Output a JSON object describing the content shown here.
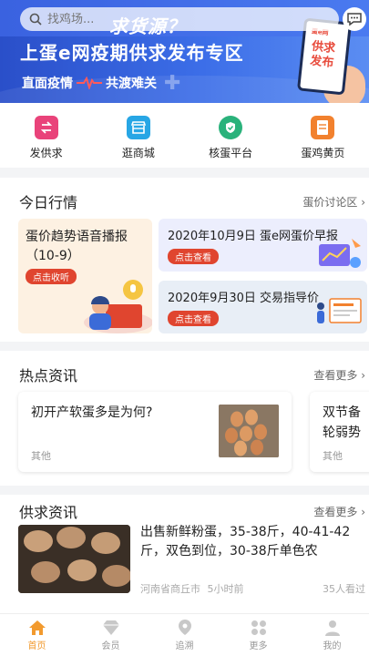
{
  "search": {
    "placeholder": "找鸡场..."
  },
  "banner": {
    "tagline": "求货源？",
    "headline": "上蛋e网疫期供求发布专区",
    "sub_left": "直面疫情",
    "sub_right": "共渡难关",
    "phone_logo": "蛋e网",
    "phone_text": "供求发布"
  },
  "quicknav": [
    {
      "label": "发供求",
      "icon": "exchange-icon",
      "color": "#e9437a"
    },
    {
      "label": "逛商城",
      "icon": "store-icon",
      "color": "#27a6e5"
    },
    {
      "label": "核蛋平台",
      "icon": "shield-check-icon",
      "color": "#2ab27b"
    },
    {
      "label": "蛋鸡黄页",
      "icon": "book-icon",
      "color": "#f2812e"
    }
  ],
  "market": {
    "title": "今日行情",
    "more": "蛋价讨论区 ›",
    "card_left": {
      "title": "蛋价趋势语音播报（10-9）",
      "button": "点击收听"
    },
    "card_right_top": {
      "title": "2020年10月9日 蛋e网蛋价早报",
      "button": "点击查看"
    },
    "card_right_bottom": {
      "title": "2020年9月30日 交易指导价",
      "button": "点击查看"
    }
  },
  "hot": {
    "title": "热点资讯",
    "more": "查看更多 ›",
    "items": [
      {
        "title": "初开产软蛋多是为何?",
        "category": "其他"
      },
      {
        "title": "双节备\n轮弱势",
        "category": "其他"
      }
    ]
  },
  "supply": {
    "title": "供求资讯",
    "more": "查看更多 ›",
    "item": {
      "text": "出售新鲜粉蛋，35-38斤，40-41-42斤，双色到位，30-38斤单色农",
      "location": "河南省商丘市",
      "time": "5小时前",
      "views": "35人看过"
    }
  },
  "tabs": [
    {
      "label": "首页",
      "icon": "home-icon",
      "active": true
    },
    {
      "label": "会员",
      "icon": "diamond-icon",
      "active": false
    },
    {
      "label": "追溯",
      "icon": "location-pin-icon",
      "active": false
    },
    {
      "label": "更多",
      "icon": "grid-icon",
      "active": false
    },
    {
      "label": "我的",
      "icon": "user-icon",
      "active": false
    }
  ],
  "colors": {
    "accent": "#f29a2e",
    "tag_red": "#e0452f",
    "banner_blue": "#2a4fc9"
  }
}
